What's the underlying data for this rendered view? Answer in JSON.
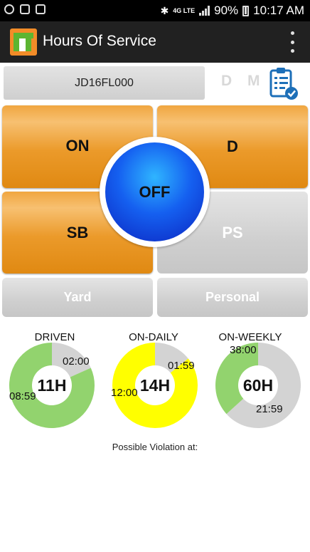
{
  "status_bar": {
    "battery": "90%",
    "time": "10:17 AM",
    "network": "4G LTE"
  },
  "app_bar": {
    "title": "Hours Of Service",
    "logo_icon": "truck-logo-icon",
    "menu_icon": "overflow-menu-icon"
  },
  "vehicle": {
    "id": "JD16FL000"
  },
  "mode_toggles": {
    "d_label": "D",
    "m_label": "M"
  },
  "clipboard_icon": "clipboard-check-icon",
  "duty_status": {
    "on": "ON",
    "d": "D",
    "off": "OFF",
    "sb": "SB",
    "ps": "PS",
    "yard": "Yard",
    "personal": "Personal"
  },
  "gauges": [
    {
      "title": "DRIVEN",
      "center": "11H",
      "used_label": "08:59",
      "remaining_label": "02:00",
      "used_fraction": 0.817,
      "used_color": "#92d36e",
      "remaining_color": "#d3d3d3"
    },
    {
      "title": "ON-DAILY",
      "center": "14H",
      "used_label": "12:00",
      "remaining_label": "01:59",
      "used_fraction": 0.858,
      "used_color": "#ffff00",
      "remaining_color": "#d3d3d3"
    },
    {
      "title": "ON-WEEKLY",
      "center": "60H",
      "used_label": "21:59",
      "remaining_label": "38:00",
      "used_fraction": 0.367,
      "used_color": "#92d36e",
      "remaining_color": "#d3d3d3"
    }
  ],
  "violation_text": "Possible Violation at:"
}
